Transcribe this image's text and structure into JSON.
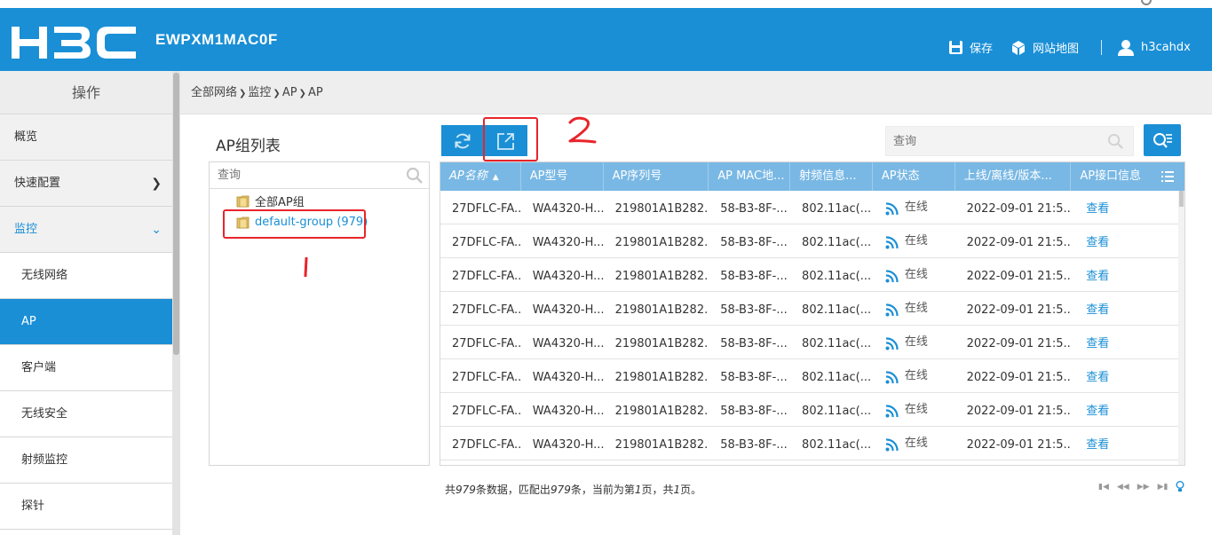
{
  "header": {
    "logo_text": "H3C",
    "device_name": "EWPXM1MAC0F",
    "save_label": "保存",
    "sitemap_label": "网站地图",
    "username": "h3cahdx"
  },
  "sidebar": {
    "title": "操作",
    "items": [
      {
        "label": "概览"
      },
      {
        "label": "快速配置"
      },
      {
        "label": "监控"
      },
      {
        "label": "无线网络"
      },
      {
        "label": "AP"
      },
      {
        "label": "客户端"
      },
      {
        "label": "无线安全"
      },
      {
        "label": "射频监控"
      },
      {
        "label": "探针"
      }
    ]
  },
  "breadcrumb": [
    "全部网络",
    "监控",
    "AP",
    "AP"
  ],
  "group_panel": {
    "title": "AP组列表",
    "search_placeholder": "查询",
    "tree": [
      "全部AP组",
      "default-group (979)"
    ]
  },
  "annotations": {
    "one": "1",
    "two": "2"
  },
  "toolbar": {
    "search_placeholder": "查询"
  },
  "table": {
    "columns": [
      "AP名称",
      "AP型号",
      "AP序列号",
      "AP MAC地...",
      "射频信息...",
      "AP状态",
      "上线/离线/版本...",
      "AP接口信息"
    ],
    "rows": [
      [
        "27DFLC-FA...",
        "WA4320-H...",
        "219801A1B282...",
        "58-B3-8F-...",
        "802.11ac(...",
        "在线",
        "2022-09-01 21:5...",
        "查看"
      ],
      [
        "27DFLC-FA...",
        "WA4320-H...",
        "219801A1B282...",
        "58-B3-8F-...",
        "802.11ac(...",
        "在线",
        "2022-09-01 21:5...",
        "查看"
      ],
      [
        "27DFLC-FA...",
        "WA4320-H...",
        "219801A1B282...",
        "58-B3-8F-...",
        "802.11ac(...",
        "在线",
        "2022-09-01 21:5...",
        "查看"
      ],
      [
        "27DFLC-FA...",
        "WA4320-H...",
        "219801A1B282...",
        "58-B3-8F-...",
        "802.11ac(...",
        "在线",
        "2022-09-01 21:5...",
        "查看"
      ],
      [
        "27DFLC-FA...",
        "WA4320-H...",
        "219801A1B282...",
        "58-B3-8F-...",
        "802.11ac(...",
        "在线",
        "2022-09-01 21:5...",
        "查看"
      ],
      [
        "27DFLC-FA...",
        "WA4320-H...",
        "219801A1B282...",
        "58-B3-8F-...",
        "802.11ac(...",
        "在线",
        "2022-09-01 21:5...",
        "查看"
      ],
      [
        "27DFLC-FA...",
        "WA4320-H...",
        "219801A1B282...",
        "58-B3-8F-...",
        "802.11ac(...",
        "在线",
        "2022-09-01 21:5...",
        "查看"
      ],
      [
        "27DFLC-FA...",
        "WA4320-H...",
        "219801A1B282...",
        "58-B3-8F-...",
        "802.11ac(...",
        "在线",
        "2022-09-01 21:5...",
        "查看"
      ]
    ]
  },
  "footer": {
    "prefix": "共",
    "total": "979",
    "mid1": "条数据，匹配出",
    "matched": "979",
    "mid2": "条，当前为第",
    "page": "1",
    "mid3": "页，共",
    "pages": "1",
    "suffix": "页。"
  },
  "colors": {
    "brand_blue": "#1a8fd6",
    "table_header": "#79b8e4",
    "annotation_red": "#e8242a"
  }
}
